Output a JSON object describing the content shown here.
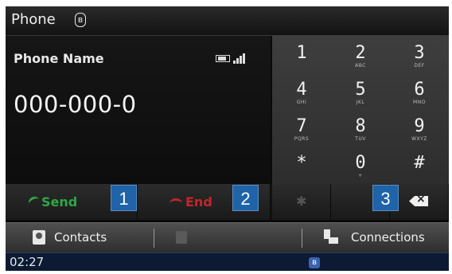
{
  "header": {
    "title": "Phone",
    "bt_icon": "bluetooth-icon"
  },
  "phone": {
    "name": "Phone Name",
    "number": "000-000-0",
    "status_icons": [
      "battery-icon",
      "signal-strength-icon"
    ]
  },
  "keypad": {
    "keys": [
      {
        "digit": "1",
        "letters": ""
      },
      {
        "digit": "2",
        "letters": "ABC"
      },
      {
        "digit": "3",
        "letters": "DEF"
      },
      {
        "digit": "4",
        "letters": "GHI"
      },
      {
        "digit": "5",
        "letters": "JKL"
      },
      {
        "digit": "6",
        "letters": "MNO"
      },
      {
        "digit": "7",
        "letters": "PQRS"
      },
      {
        "digit": "8",
        "letters": "TUV"
      },
      {
        "digit": "9",
        "letters": "WXYZ"
      },
      {
        "digit": "*",
        "letters": ""
      },
      {
        "digit": "0",
        "letters": "+"
      },
      {
        "digit": "#",
        "letters": ""
      }
    ]
  },
  "actions": {
    "send_label": "Send",
    "end_label": "End",
    "backspace_icon": "backspace-icon"
  },
  "callouts": [
    "1",
    "2",
    "3"
  ],
  "menu": {
    "contacts_label": "Contacts",
    "connections_label": "Connections"
  },
  "status_bar": {
    "time": "02:27"
  },
  "colors": {
    "send": "#2fa744",
    "end": "#c4252a",
    "callout": "#1f63a8",
    "status_bar": "#0c1a33"
  }
}
